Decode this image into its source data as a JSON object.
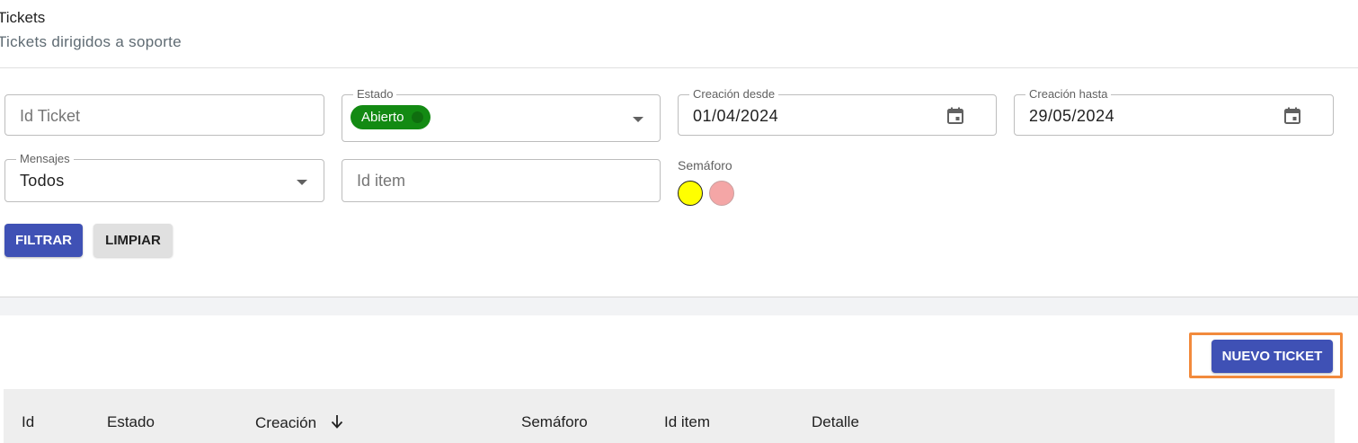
{
  "header": {
    "title": "Tickets",
    "subtitle": "Tickets dirigidos a soporte"
  },
  "filters": {
    "id_ticket": {
      "placeholder": "Id Ticket",
      "value": ""
    },
    "estado": {
      "label": "Estado",
      "chip": "Abierto"
    },
    "creacion_desde": {
      "label": "Creación desde",
      "value": "01/04/2024"
    },
    "creacion_hasta": {
      "label": "Creación hasta",
      "value": "29/05/2024"
    },
    "mensajes": {
      "label": "Mensajes",
      "value": "Todos"
    },
    "id_item": {
      "placeholder": "Id item",
      "value": ""
    },
    "semaforo": {
      "label": "Semáforo",
      "colors": [
        "#ffff00",
        "#f4a6a6"
      ]
    }
  },
  "actions": {
    "filtrar": "FILTRAR",
    "limpiar": "LIMPIAR",
    "nuevo_ticket": "NUEVO TICKET"
  },
  "table": {
    "columns": [
      "Id",
      "Estado",
      "Creación",
      "Semáforo",
      "Id item",
      "Detalle"
    ],
    "sorted_column": "Creación",
    "sort_direction": "descending"
  },
  "colors": {
    "primary": "#3f51b5",
    "chip_green": "#138a13",
    "highlight": "#f28a3c"
  }
}
